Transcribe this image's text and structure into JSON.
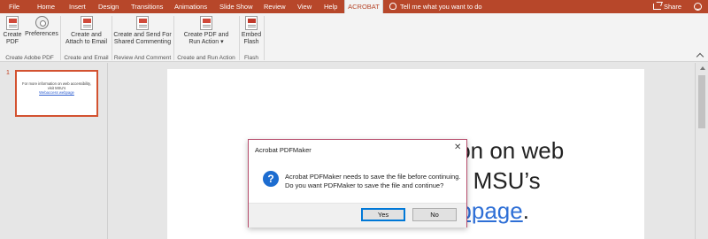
{
  "tabs": [
    {
      "label": "File"
    },
    {
      "label": "Home"
    },
    {
      "label": "Insert"
    },
    {
      "label": "Design"
    },
    {
      "label": "Transitions"
    },
    {
      "label": "Animations"
    },
    {
      "label": "Slide Show"
    },
    {
      "label": "Review"
    },
    {
      "label": "View"
    },
    {
      "label": "Help"
    },
    {
      "label": "ACROBAT"
    }
  ],
  "active_tab": "ACROBAT",
  "tell_me": "Tell me what you want to do",
  "share": "Share",
  "ribbon": {
    "buttons": [
      {
        "label1": "Create",
        "label2": "PDF"
      },
      {
        "label1": "Preferences",
        "label2": ""
      },
      {
        "label1": "Create and",
        "label2": "Attach to Email"
      },
      {
        "label1": "Create and Send For",
        "label2": "Shared Commenting"
      },
      {
        "label1": "Create PDF and",
        "label2": "Run Action ▾"
      },
      {
        "label1": "Embed",
        "label2": "Flash"
      }
    ],
    "groups": [
      {
        "label": "Create Adobe PDF"
      },
      {
        "label": "Create and Email"
      },
      {
        "label": "Review And Comment"
      },
      {
        "label": "Create and Run Action"
      },
      {
        "label": "Flash"
      }
    ]
  },
  "slide_panel": {
    "slide_number": "1",
    "thumb_text": "For more information on web accessibility, visit MSU's",
    "thumb_link": "Webaccess webpage"
  },
  "slide": {
    "line1": "For more information on web",
    "line2": "accessibility, visit MSU’s",
    "link": "Webaccess webpage",
    "period": "."
  },
  "dialog": {
    "title": "Acrobat PDFMaker",
    "close": "✕",
    "icon": "?",
    "message_line1": "Acrobat PDFMaker needs to save the file before continuing.",
    "message_line2": "Do you want PDFMaker to save the file and continue?",
    "yes_label": "Yes",
    "no_label": "No"
  },
  "colors": {
    "accent": "#b7472a",
    "dialog_border": "#b84f6e",
    "link": "#2e6fd6",
    "question_icon": "#1c6cd0"
  }
}
